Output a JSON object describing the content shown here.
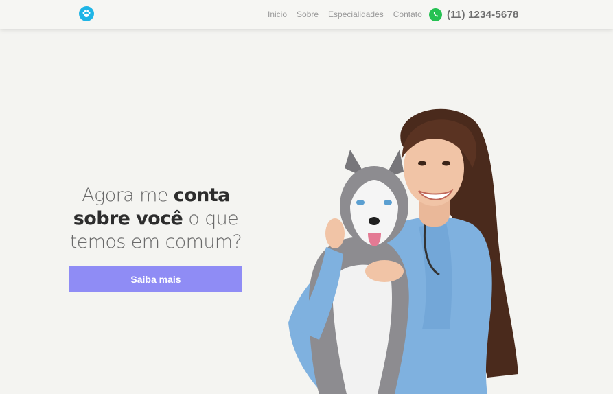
{
  "header": {
    "logo_icon": "paw-icon",
    "nav": [
      {
        "label": "Inicio"
      },
      {
        "label": "Sobre"
      },
      {
        "label": "Especialidades"
      },
      {
        "label": "Contato"
      }
    ],
    "whatsapp_icon": "whatsapp-icon",
    "phone": "(11) 1234-5678"
  },
  "hero": {
    "line1_light": "Agora me ",
    "line1_bold": "conta",
    "line2_bold": "sobre você",
    "line2_light": " o que",
    "line3_light": "temos em comum?",
    "cta_label": "Saiba mais",
    "image_icon": "vet-with-husky-photo"
  },
  "colors": {
    "background": "#f4f4f1",
    "accent": "#8f8cf5",
    "logo": "#1fb5e6",
    "whatsapp": "#25c152"
  }
}
